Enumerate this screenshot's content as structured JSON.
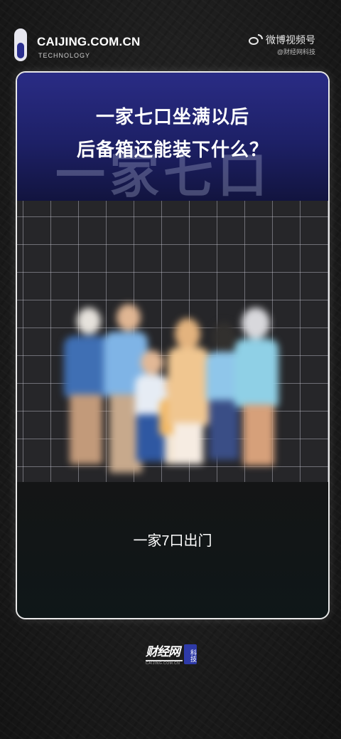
{
  "brand": {
    "name": "CAIJING.COM.CN",
    "tagline": "TECHNOLOGY"
  },
  "watermark": {
    "platform": "微博视频号",
    "handle": "@财经网科技"
  },
  "card": {
    "title_line1": "一家七口坐满以后",
    "title_line2": "后备箱还能装下什么？",
    "background_text": "一家七口",
    "caption": "一家7口出门",
    "header_color": "#22257a",
    "border_color": "#e9e9e9"
  },
  "footer": {
    "logo_main": "财经网",
    "logo_side": "科技",
    "logo_sub": "CAIJING.COM.CN"
  },
  "icons": {
    "brand": "caijing-logo-icon",
    "weibo": "weibo-icon"
  }
}
